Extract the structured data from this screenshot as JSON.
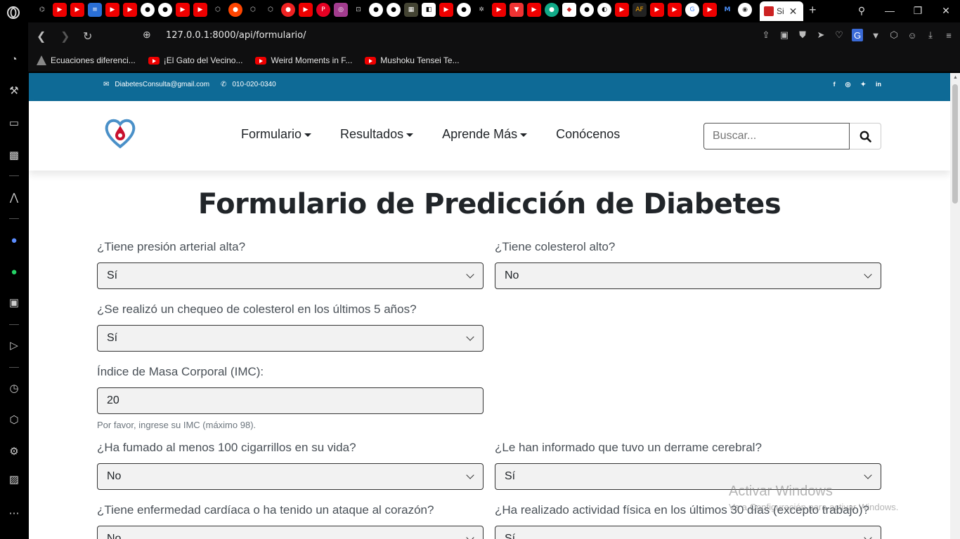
{
  "browser": {
    "active_tab_title": "Si",
    "url": "127.0.0.1:8000/api/formulario/",
    "bookmarks": [
      {
        "label": "Ecuaciones diferenci...",
        "icon": "triangle-icon"
      },
      {
        "label": "¡El Gato del Vecino...",
        "icon": "youtube-icon"
      },
      {
        "label": "Weird Moments in F...",
        "icon": "youtube-icon"
      },
      {
        "label": "Mushoku Tensei Te...",
        "icon": "youtube-icon"
      }
    ]
  },
  "topbar": {
    "email": "DiabetesConsulta@gmail.com",
    "phone": "010-020-0340",
    "social": [
      "f",
      "ig",
      "t",
      "in"
    ]
  },
  "nav": {
    "items": [
      {
        "label": "Formulario",
        "dropdown": true
      },
      {
        "label": "Resultados",
        "dropdown": true
      },
      {
        "label": "Aprende Más",
        "dropdown": true
      },
      {
        "label": "Conócenos",
        "dropdown": false
      }
    ],
    "search_placeholder": "Buscar..."
  },
  "form": {
    "title": "Formulario de Predicción de Diabetes",
    "fields": {
      "presion": {
        "label": "¿Tiene presión arterial alta?",
        "value": "Sí"
      },
      "colesterol": {
        "label": "¿Tiene colesterol alto?",
        "value": "No"
      },
      "chequeo": {
        "label": "¿Se realizó un chequeo de colesterol en los últimos 5 años?",
        "value": "Sí"
      },
      "imc": {
        "label": "Índice de Masa Corporal (IMC):",
        "value": "20",
        "help": "Por favor, ingrese su IMC (máximo 98)."
      },
      "fumado": {
        "label": "¿Ha fumado al menos 100 cigarrillos en su vida?",
        "value": "No"
      },
      "derrame": {
        "label": "¿Le han informado que tuvo un derrame cerebral?",
        "value": "Sí"
      },
      "cardiaca": {
        "label": "¿Tiene enfermedad cardíaca o ha tenido un ataque al corazón?",
        "value": "No"
      },
      "actividad": {
        "label": "¿Ha realizado actividad física en los últimos 30 días (excepto trabajo)?",
        "value": "Sí"
      }
    }
  },
  "watermark": {
    "line1": "Activar Windows",
    "line2": "Ve a Configuración para activar Windows."
  },
  "colors": {
    "topbar": "#0e6a96",
    "accent_red": "#c8102e"
  }
}
